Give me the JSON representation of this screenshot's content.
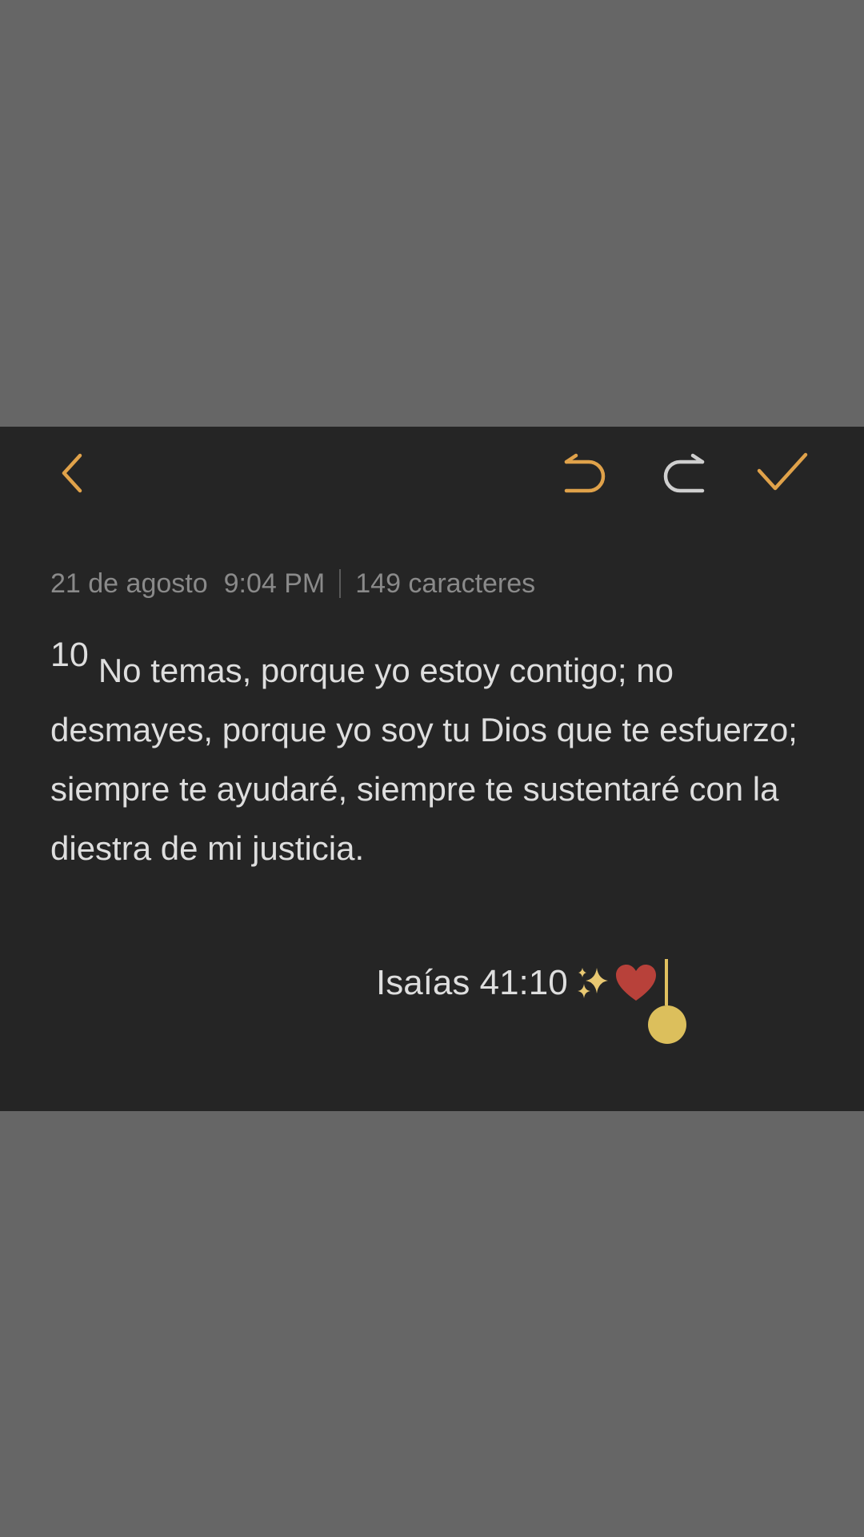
{
  "toolbar": {
    "back_icon": "chevron-left-icon",
    "undo_icon": "undo-icon",
    "redo_icon": "redo-icon",
    "done_icon": "checkmark-icon",
    "accent_color": "#E0A24A",
    "disabled_color": "#CFCFCF"
  },
  "note": {
    "date": "21 de agosto",
    "time": "9:04 PM",
    "char_count": "149 caracteres",
    "verse_number": "10",
    "verse_text": "No temas, porque yo estoy contigo; no desmayes, porque yo soy tu Dios que te esfuerzo; siempre te ayudaré, siempre te sustentaré con la diestra de mi justicia.",
    "reference": "Isaías 41:10",
    "emoji_icons": [
      "sparkles-icon",
      "red-heart-icon"
    ]
  },
  "colors": {
    "background_dim": "#666666",
    "panel_background": "#252525",
    "text_primary": "#DEDEDE",
    "text_secondary": "#8A8A8A",
    "cursor_color": "#DCBF5C"
  }
}
